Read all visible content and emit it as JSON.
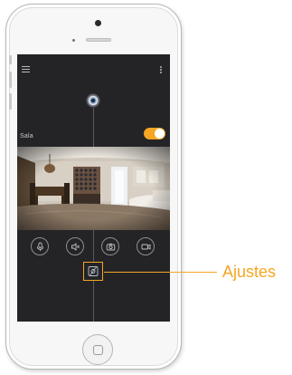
{
  "screen": {
    "menu_icon": "hamburger-menu-icon",
    "more_icon": "vertical-dots-icon",
    "camera_status_icon": "camera-lens-icon",
    "room": {
      "label": "Sala",
      "toggle_on": true,
      "toggle_color": "#f5a623"
    },
    "controls": [
      {
        "name": "microphone-button",
        "icon": "microphone-icon"
      },
      {
        "name": "speaker-button",
        "icon": "speaker-icon"
      },
      {
        "name": "snapshot-button",
        "icon": "camera-icon"
      },
      {
        "name": "record-button",
        "icon": "video-camera-icon"
      }
    ],
    "settings_button": {
      "icon": "settings-icon",
      "highlight_color": "#f5a623"
    }
  },
  "annotation": {
    "label": "Ajustes",
    "color": "#f5a623"
  },
  "colors": {
    "screen_background": "#242427",
    "accent": "#f5a623"
  }
}
